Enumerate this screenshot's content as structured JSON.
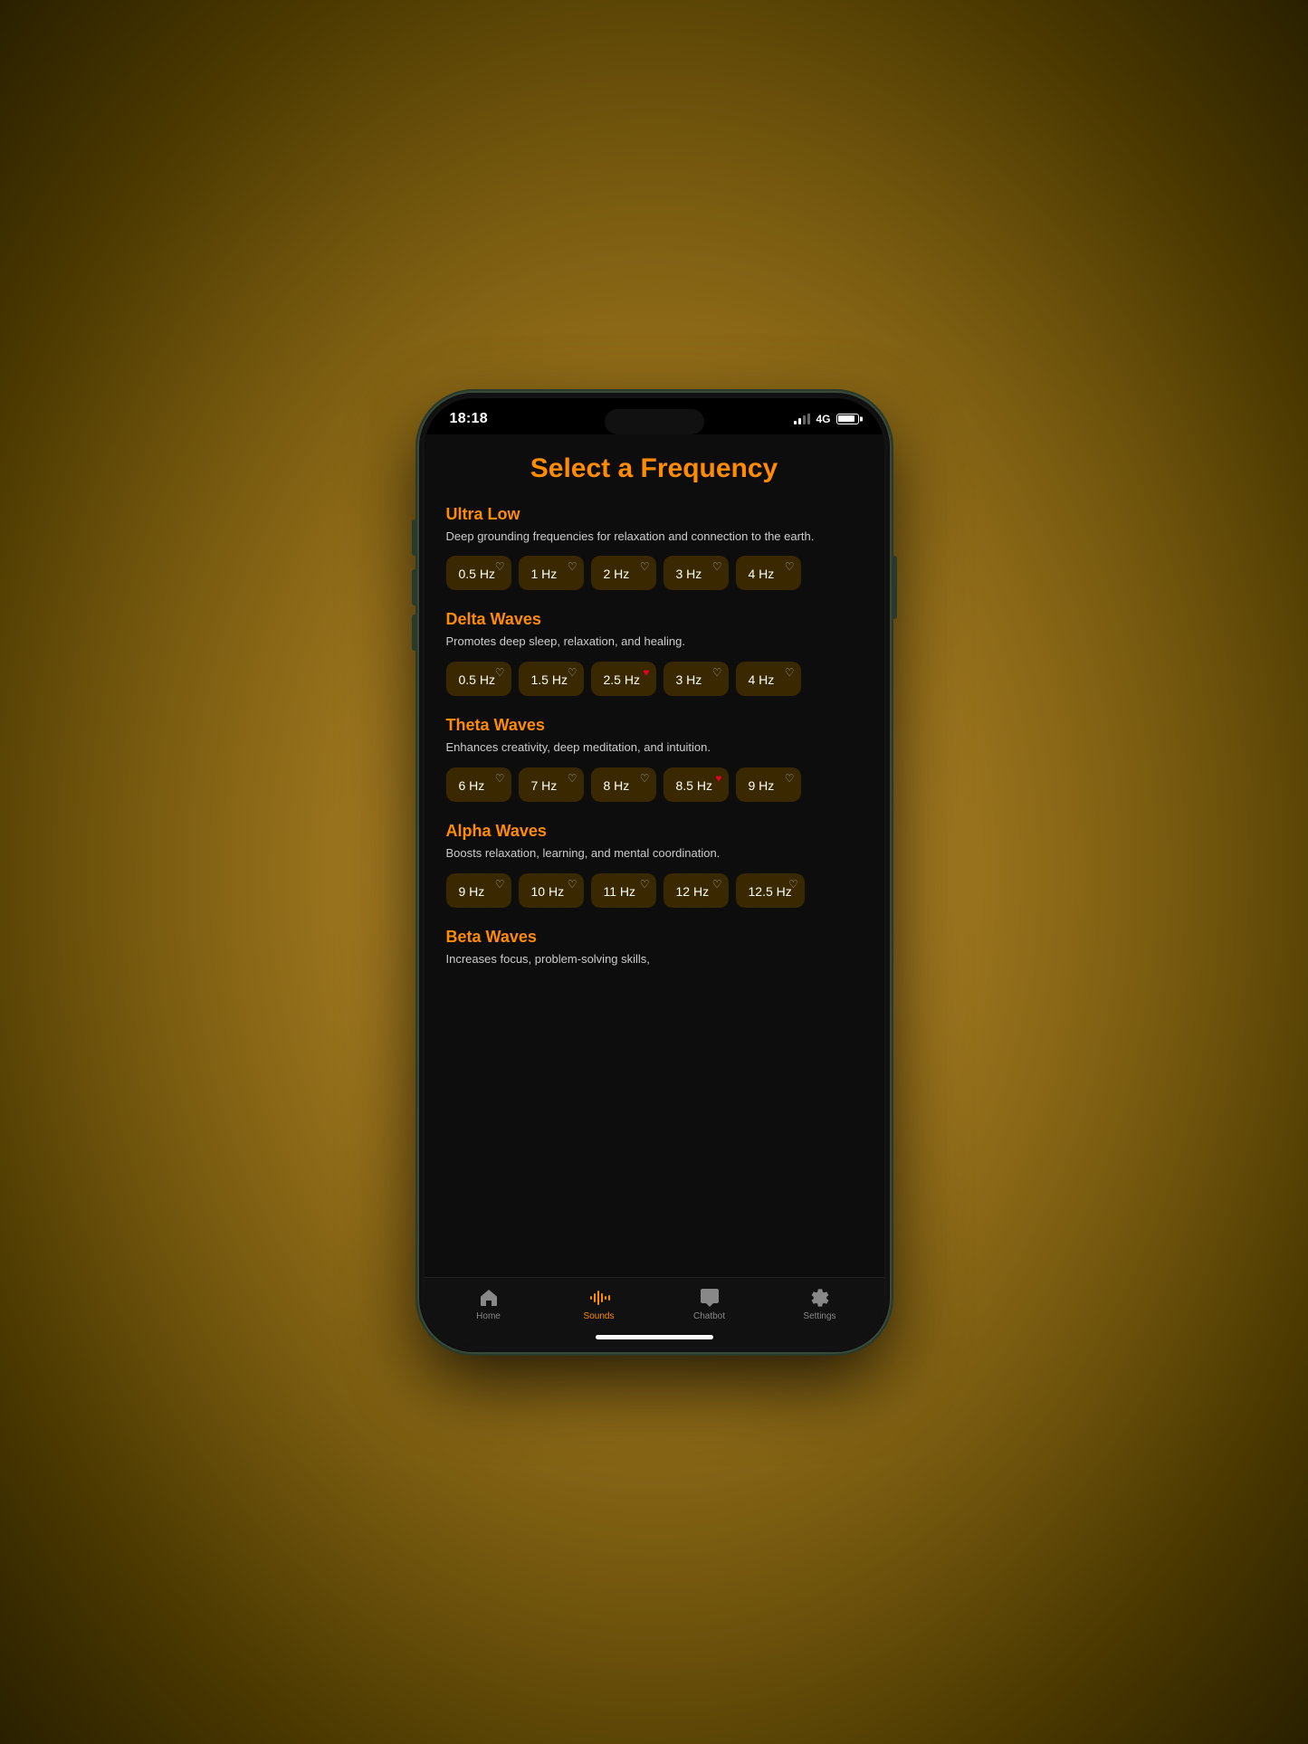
{
  "statusBar": {
    "time": "18:18",
    "network": "4G"
  },
  "page": {
    "title": "Select a Frequency"
  },
  "categories": [
    {
      "id": "ultra-low",
      "title": "Ultra Low",
      "description": "Deep grounding frequencies for relaxation and connection to the earth.",
      "frequencies": [
        {
          "label": "0.5 Hz",
          "favorited": false
        },
        {
          "label": "1 Hz",
          "favorited": false
        },
        {
          "label": "2 Hz",
          "favorited": false
        },
        {
          "label": "3 Hz",
          "favorited": false
        },
        {
          "label": "4 Hz",
          "favorited": false
        }
      ]
    },
    {
      "id": "delta-waves",
      "title": "Delta Waves",
      "description": "Promotes deep sleep, relaxation, and healing.",
      "frequencies": [
        {
          "label": "0.5 Hz",
          "favorited": false
        },
        {
          "label": "1.5 Hz",
          "favorited": false
        },
        {
          "label": "2.5 Hz",
          "favorited": true
        },
        {
          "label": "3 Hz",
          "favorited": false
        },
        {
          "label": "4 Hz",
          "favorited": false
        }
      ]
    },
    {
      "id": "theta-waves",
      "title": "Theta Waves",
      "description": "Enhances creativity, deep meditation, and intuition.",
      "frequencies": [
        {
          "label": "6 Hz",
          "favorited": false
        },
        {
          "label": "7 Hz",
          "favorited": false
        },
        {
          "label": "8 Hz",
          "favorited": false
        },
        {
          "label": "8.5 Hz",
          "favorited": true
        },
        {
          "label": "9 Hz",
          "favorited": false
        }
      ]
    },
    {
      "id": "alpha-waves",
      "title": "Alpha Waves",
      "description": "Boosts relaxation, learning, and mental coordination.",
      "frequencies": [
        {
          "label": "9 Hz",
          "favorited": false
        },
        {
          "label": "10 Hz",
          "favorited": false
        },
        {
          "label": "11 Hz",
          "favorited": false
        },
        {
          "label": "12 Hz",
          "favorited": false
        },
        {
          "label": "12.5 Hz",
          "favorited": false
        }
      ]
    },
    {
      "id": "beta-waves",
      "title": "Beta Waves",
      "description": "Increases focus, problem-solving skills,",
      "frequencies": []
    }
  ],
  "bottomNav": {
    "items": [
      {
        "id": "home",
        "label": "Home",
        "active": false,
        "icon": "home"
      },
      {
        "id": "sounds",
        "label": "Sounds",
        "active": true,
        "icon": "waveform"
      },
      {
        "id": "chatbot",
        "label": "Chatbot",
        "active": false,
        "icon": "chat"
      },
      {
        "id": "settings",
        "label": "Settings",
        "active": false,
        "icon": "gear"
      }
    ]
  }
}
